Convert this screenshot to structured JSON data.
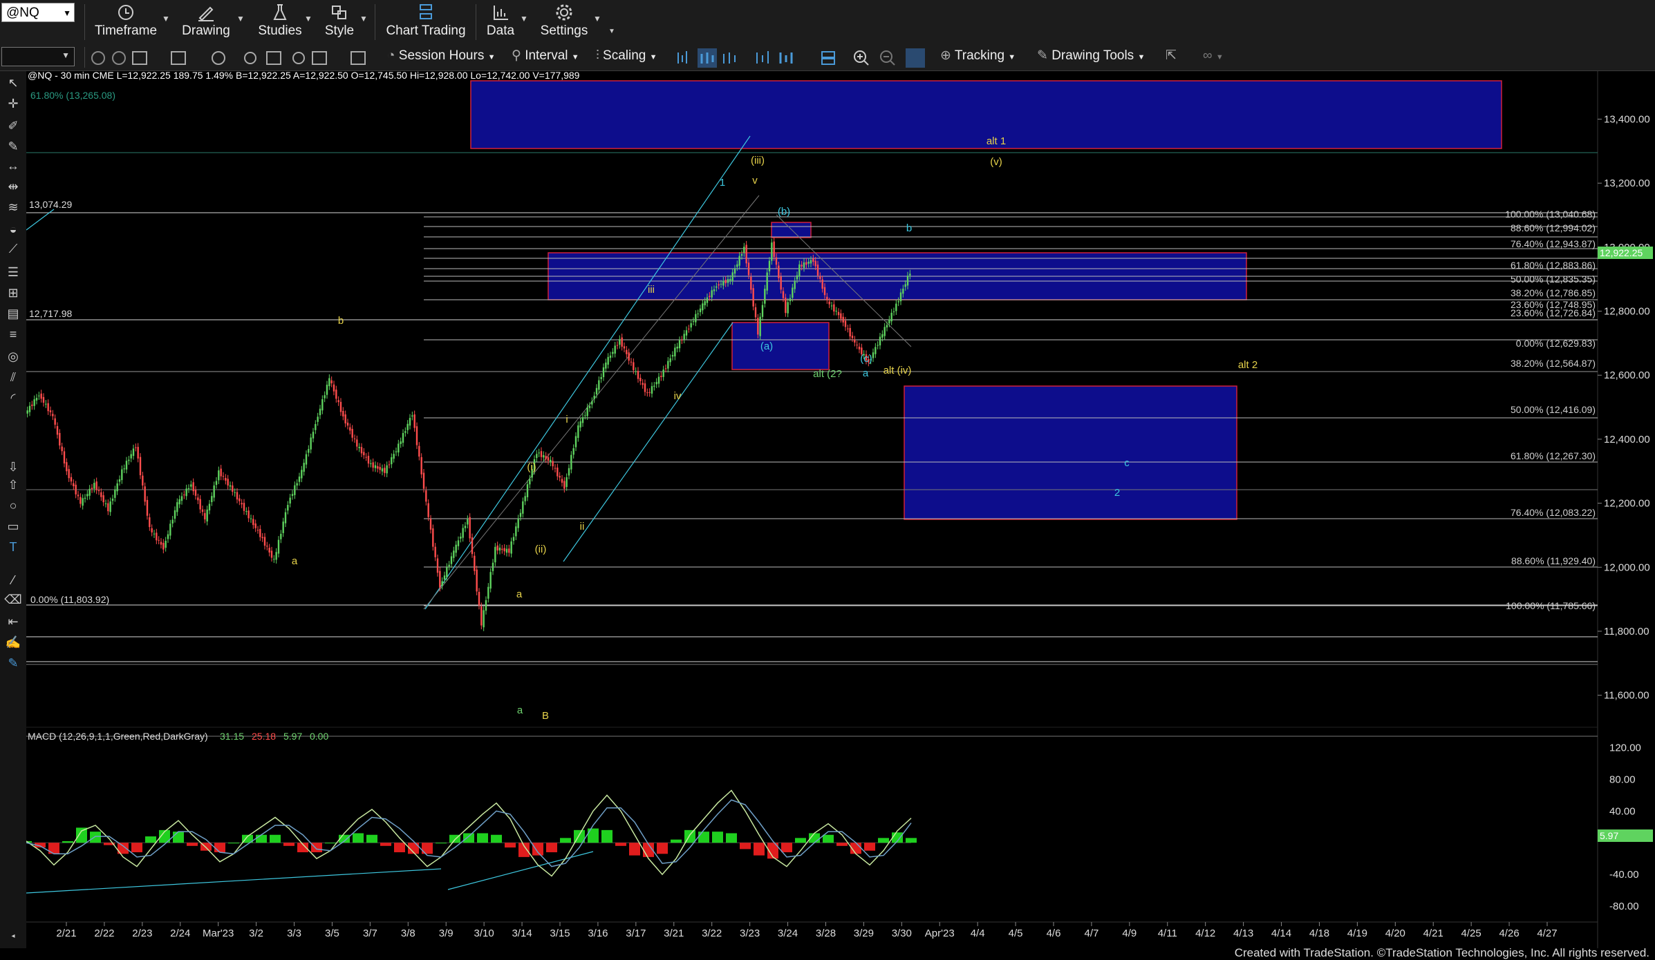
{
  "toolbar": {
    "symbol": "@NQ",
    "timeframe": "Timeframe",
    "drawing": "Drawing",
    "studies": "Studies",
    "style": "Style",
    "chart_trading": "Chart Trading",
    "data": "Data",
    "settings": "Settings",
    "session_hours": "Session Hours",
    "interval": "Interval",
    "scaling": "Scaling",
    "tracking": "Tracking",
    "drawing_tools": "Drawing Tools"
  },
  "status_line": "@NQ - 30 min  CME   L=12,922.25  189.75  1.49%  B=12,922.25  A=12,922.50  O=12,745.50  Hi=12,928.00  Lo=12,742.00  V=177,989",
  "macd_label": "MACD (12,26,9,1,1,Green,Red,DarkGray)",
  "macd_values": [
    "31.15",
    "25.18",
    "5.97",
    "0.00"
  ],
  "footer": "Created with TradeStation. ©TradeStation Technologies, Inc. All rights reserved.",
  "colors": {
    "up": "#5fd35f",
    "down": "#ff4d4d",
    "zone": "#0d0d8c",
    "zone_border": "#d0203a",
    "fib": "#c8c8c8",
    "wave_yellow": "#e6d24a",
    "wave_cyan": "#3ec8e0",
    "wave_green": "#6fd26f"
  },
  "chart_data": {
    "type": "line",
    "symbol": "@NQ",
    "interval": "30 min",
    "ylim": [
      11500,
      13550
    ],
    "price_ticks": [
      "13,400.00",
      "13,200.00",
      "13,000.00",
      "12,800.00",
      "12,600.00",
      "12,400.00",
      "12,200.00",
      "12,000.00",
      "11,800.00",
      "11,600.00"
    ],
    "price_tick_values": [
      13400,
      13200,
      13000,
      12800,
      12600,
      12400,
      12200,
      12000,
      11800,
      11600
    ],
    "last_price": "12,922.25",
    "last_price_value": 12922.25,
    "date_ticks": [
      "2/21",
      "2/22",
      "2/23",
      "2/24",
      "Mar'23",
      "3/2",
      "3/3",
      "3/5",
      "3/7",
      "3/8",
      "3/9",
      "3/10",
      "3/14",
      "3/15",
      "3/16",
      "3/17",
      "3/21",
      "3/22",
      "3/23",
      "3/24",
      "3/28",
      "3/29",
      "3/30",
      "Apr'23",
      "4/4",
      "4/5",
      "4/6",
      "4/7",
      "4/9",
      "4/11",
      "4/12",
      "4/13",
      "4/14",
      "4/18",
      "4/19",
      "4/20",
      "4/21",
      "4/25",
      "4/26",
      "4/27"
    ],
    "price_series": [
      12480,
      12540,
      12470,
      12300,
      12200,
      12260,
      12180,
      12300,
      12380,
      12120,
      12060,
      12200,
      12260,
      12150,
      12300,
      12240,
      12170,
      12100,
      12020,
      12200,
      12300,
      12450,
      12590,
      12470,
      12380,
      12320,
      12300,
      12380,
      12480,
      12200,
      11940,
      12050,
      12150,
      11820,
      12060,
      12050,
      12200,
      12360,
      12330,
      12250,
      12440,
      12520,
      12640,
      12710,
      12620,
      12540,
      12600,
      12680,
      12750,
      12820,
      12880,
      12900,
      13000,
      12730,
      13010,
      12800,
      12940,
      12960,
      12830,
      12780,
      12700,
      12640,
      12730,
      12820,
      12922
    ],
    "macd_ylim": [
      -100,
      130
    ],
    "macd_ticks": [
      "120.00",
      "80.00",
      "40.00",
      "-40.00",
      "-80.00"
    ],
    "macd_tick_values": [
      120,
      80,
      40,
      -40,
      -80
    ],
    "macd_last": "5.97",
    "macd_series": [
      2,
      -10,
      -28,
      -12,
      15,
      22,
      5,
      -18,
      -30,
      -8,
      14,
      28,
      10,
      -6,
      -24,
      -14,
      8,
      20,
      32,
      18,
      -2,
      -20,
      -10,
      12,
      30,
      42,
      26,
      6,
      -12,
      -30,
      -18,
      4,
      20,
      36,
      50,
      30,
      -4,
      -28,
      -42,
      -20,
      10,
      40,
      60,
      40,
      10,
      -20,
      -40,
      -20,
      10,
      30,
      50,
      66,
      40,
      10,
      -18,
      -30,
      -10,
      12,
      24,
      10,
      -14,
      -28,
      -10,
      15,
      31
    ],
    "macd_signal": [
      0,
      -4,
      -14,
      -14,
      -4,
      8,
      8,
      -4,
      -18,
      -16,
      -2,
      14,
      14,
      4,
      -12,
      -14,
      -2,
      10,
      22,
      22,
      10,
      -8,
      -10,
      2,
      18,
      32,
      30,
      18,
      2,
      -16,
      -18,
      -6,
      8,
      24,
      40,
      36,
      14,
      -12,
      -30,
      -26,
      -6,
      22,
      44,
      44,
      26,
      -2,
      -26,
      -24,
      -6,
      16,
      36,
      54,
      48,
      26,
      2,
      -18,
      -16,
      0,
      14,
      14,
      0,
      -18,
      -16,
      2,
      25
    ]
  },
  "annotations": {
    "fib_left": [
      "61.80% (13,265.08)",
      "13,074.29",
      "12,717.98",
      "0.00% (11,803.92)"
    ],
    "fib_right": [
      "100.00% (13,040.68)",
      "88.60% (12,994.02)",
      "76.40% (12,943.87)",
      "61.80% (12,883.86)",
      "50.00% (12,835.35)",
      "38.20% (12,786.85)",
      "23.60% (12,748.95)",
      "23.60% (12,726.84)",
      "0.00% (12,629.83)",
      "38.20% (12,564.87)",
      "50.00% (12,416.09)",
      "61.80% (12,267.30)",
      "76.40% (12,083.22)",
      "88.60% (11,929.40)",
      "100.00% (11,785.66)"
    ],
    "wave_labels": [
      "alt 1",
      "(v)",
      "(iii)",
      "v",
      "1",
      "(b)",
      "b",
      "iii",
      "ii",
      "iv",
      "i",
      "(i)",
      "(ii)",
      "ii",
      "(a)",
      "(c)",
      "a",
      "alt (2?",
      "alt (iv)",
      "alt 2",
      "c",
      "2",
      "a",
      "b",
      "a",
      "B"
    ]
  }
}
